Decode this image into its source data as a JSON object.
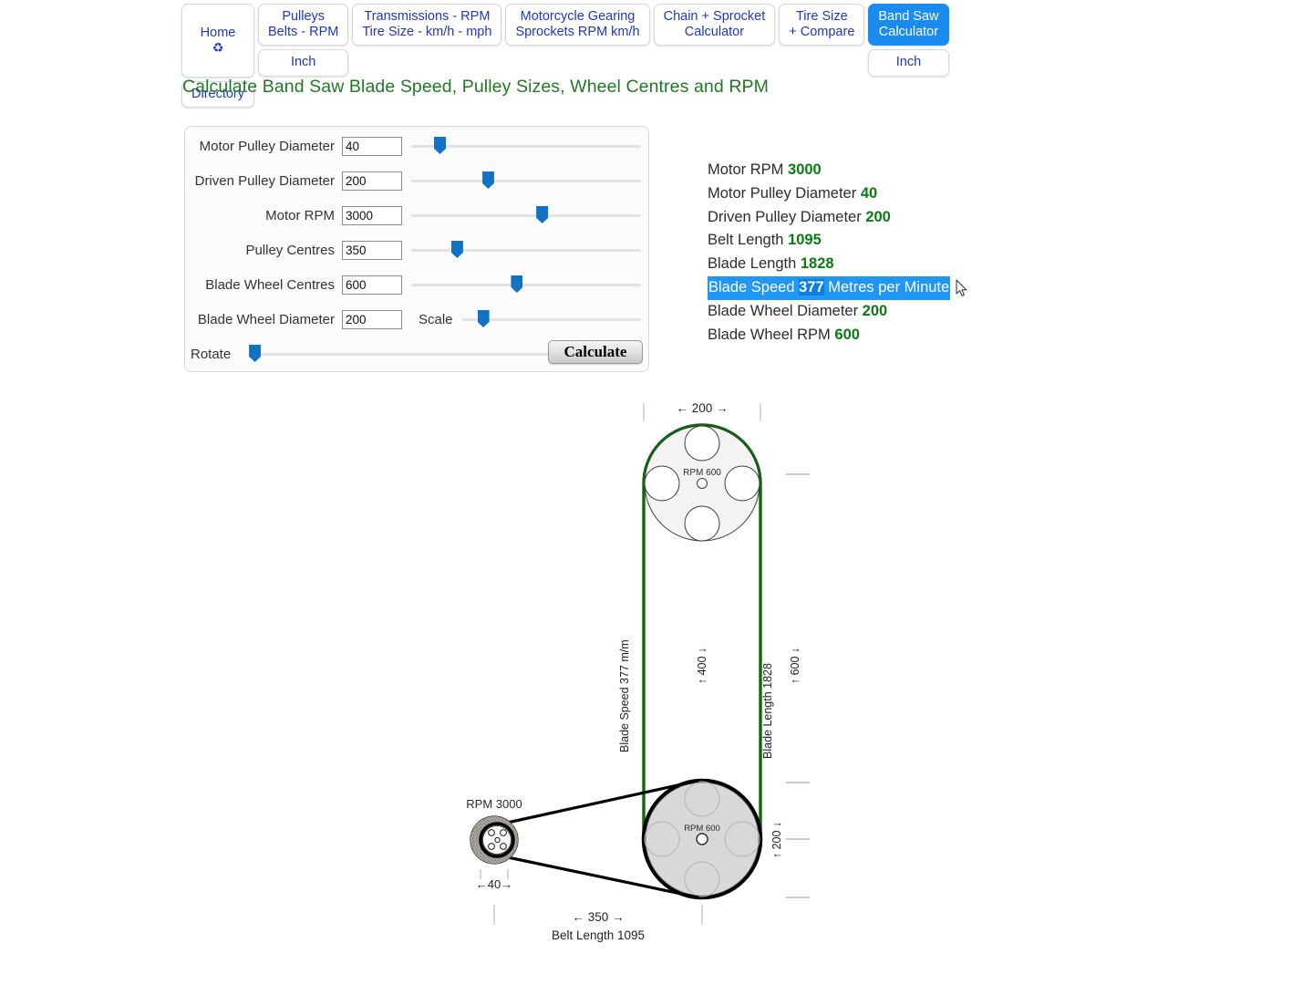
{
  "tabs": [
    {
      "label": "Home",
      "icon": "recycle-icon",
      "sub": "Directory",
      "active": false
    },
    {
      "label": "Pulleys\nBelts - RPM",
      "sub": "Inch",
      "active": false
    },
    {
      "label": "Transmissions - RPM\nTire Size - km/h - mph",
      "sub": null,
      "active": false
    },
    {
      "label": "Motorcycle Gearing\nSprockets RPM km/h",
      "sub": null,
      "active": false
    },
    {
      "label": "Chain + Sprocket\nCalculator",
      "sub": null,
      "active": false
    },
    {
      "label": "Tire Size\n+ Compare",
      "sub": null,
      "active": false
    },
    {
      "label": "Band Saw\nCalculator",
      "sub": "Inch",
      "active": true
    }
  ],
  "page": {
    "title": "Calculate Band Saw Blade Speed, Pulley Sizes, Wheel Centres and RPM",
    "title_color": "#1f7a21"
  },
  "form": {
    "rows": [
      {
        "label": "Motor Pulley Diameter",
        "value": "40",
        "slider_pct": 6
      },
      {
        "label": "Driven Pulley Diameter",
        "value": "200",
        "slider_pct": 27
      },
      {
        "label": "Motor RPM",
        "value": "3000",
        "slider_pct": 50
      },
      {
        "label": "Pulley Centres",
        "value": "350",
        "slider_pct": 14
      },
      {
        "label": "Blade Wheel Centres",
        "value": "600",
        "slider_pct": 39
      },
      {
        "label": "Blade Wheel Diameter",
        "value": "200",
        "slider_pct": 14
      }
    ],
    "scale_label": "Scale",
    "rotate_label": "Rotate",
    "rotate_pct": 1,
    "calculate_label": "Calculate"
  },
  "results": [
    {
      "label": "Motor RPM",
      "value": "3000",
      "unit": "",
      "selected": false
    },
    {
      "label": "Motor Pulley Diameter",
      "value": "40",
      "unit": "",
      "selected": false
    },
    {
      "label": "Driven Pulley Diameter",
      "value": "200",
      "unit": "",
      "selected": false
    },
    {
      "label": "Belt Length",
      "value": "1095",
      "unit": "",
      "selected": false
    },
    {
      "label": "Blade Length",
      "value": "1828",
      "unit": "",
      "selected": false
    },
    {
      "label": "Blade Speed",
      "value": "377",
      "unit": "Metres per Minute",
      "selected": true
    },
    {
      "label": "Blade Wheel Diameter",
      "value": "200",
      "unit": "",
      "selected": false
    },
    {
      "label": "Blade Wheel RPM",
      "value": "600",
      "unit": "",
      "selected": false
    }
  ],
  "diagram": {
    "colors": {
      "blade_green": "#0a6b0a",
      "belt_black": "#000000",
      "wheel_fill": "#d9d9d9",
      "top_wheel_fill": "#f2f2f2",
      "pulley_fill": "#9c9c96",
      "dim_grey": "#bbbbbb"
    },
    "labels": {
      "top_width": "← 200 →",
      "top_wheel_rpm": "RPM 600",
      "bottom_wheel_rpm": "RPM 600",
      "motor_rpm": "RPM 3000",
      "blade_speed_vertical": "Blade Speed 377 m/m",
      "blade_length_vertical": "Blade Length 1828",
      "inner_height": "↑ 400 ↓",
      "wheel_centres_height": "↑ 600 ↓",
      "wheel_diameter_height": "↑ 200 ↓",
      "motor_pulley_width": "←40→",
      "pulley_centres": "← 350 →",
      "belt_length": "Belt Length 1095"
    }
  }
}
